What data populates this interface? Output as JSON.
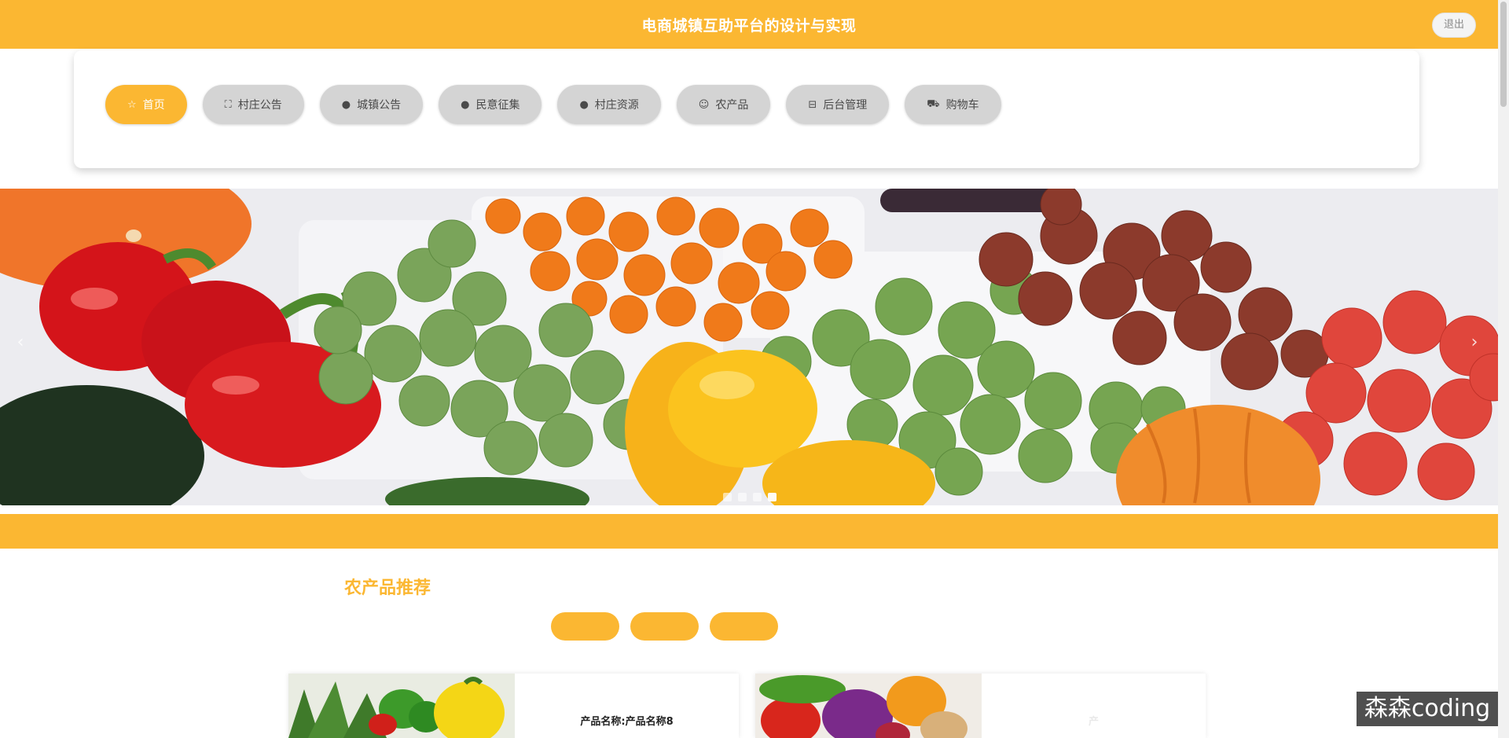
{
  "header": {
    "title": "电商城镇互助平台的设计与实现",
    "logout_label": "退出"
  },
  "nav": {
    "items": [
      {
        "label": "首页",
        "icon": "star-icon",
        "glyph": "☆",
        "active": true
      },
      {
        "label": "村庄公告",
        "icon": "bag-icon",
        "glyph": "⛶",
        "active": false
      },
      {
        "label": "城镇公告",
        "icon": "info-icon",
        "glyph": "●",
        "active": false
      },
      {
        "label": "民意征集",
        "icon": "question-icon",
        "glyph": "●",
        "active": false
      },
      {
        "label": "村庄资源",
        "icon": "info-icon",
        "glyph": "●",
        "active": false
      },
      {
        "label": "农产品",
        "icon": "smile-icon",
        "glyph": "☺",
        "active": false
      },
      {
        "label": "后台管理",
        "icon": "briefcase-icon",
        "glyph": "⊟",
        "active": false
      },
      {
        "label": "购物车",
        "icon": "cart-icon",
        "glyph": "⛟",
        "active": false
      }
    ]
  },
  "banner": {
    "slides": 4,
    "active_slide": 4
  },
  "section": {
    "title": "农产品推荐"
  },
  "products": [
    {
      "name": "产品名称:产品名称8"
    },
    {
      "name": "产"
    }
  ],
  "watermark": "森森coding",
  "colors": {
    "accent": "#fbb732",
    "nav_inactive": "#d4d4d4"
  }
}
